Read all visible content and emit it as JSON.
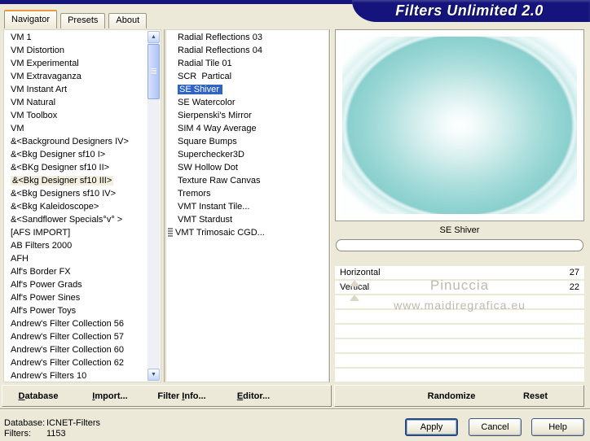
{
  "window": {
    "title": "Filters Unlimited 2.0"
  },
  "tabs": [
    {
      "label": "Navigator",
      "active": true
    },
    {
      "label": "Presets",
      "active": false
    },
    {
      "label": "About",
      "active": false
    }
  ],
  "icons": {
    "scroll_up": "▲",
    "scroll_down": "▼",
    "list_lines": "stack-lines"
  },
  "category_list": {
    "selected_index": 11,
    "items": [
      "VM 1",
      "VM Distortion",
      "VM Experimental",
      "VM Extravaganza",
      "VM Instant Art",
      "VM Natural",
      "VM Toolbox",
      "VM",
      "&<Background Designers IV>",
      "&<Bkg Designer sf10 I>",
      "&<BKg Designer sf10 II>",
      "&<Bkg Designer sf10 III>",
      "&<Bkg Designers sf10 IV>",
      "&<Bkg Kaleidoscope>",
      "&<Sandflower Specials°v° >",
      "[AFS IMPORT]",
      "AB Filters 2000",
      "AFH",
      "Alf's Border FX",
      "Alf's Power Grads",
      "Alf's Power Sines",
      "Alf's Power Toys",
      "Andrew's Filter Collection 56",
      "Andrew's Filter Collection 57",
      "Andrew's Filter Collection 60",
      "Andrew's Filter Collection 62",
      "Andrew's Filters 10"
    ]
  },
  "filter_list": {
    "selected_index": 4,
    "icon_item_index": 15,
    "items": [
      "Radial Reflections 03",
      "Radial Reflections 04",
      "Radial Tile 01",
      "SCR  Partical",
      "SE Shiver",
      "SE Watercolor",
      "Sierpenski's Mirror",
      "SIM 4 Way Average",
      "Square Bumps",
      "Superchecker3D",
      "SW Hollow Dot",
      "Texture Raw Canvas",
      "Tremors",
      "VMT Instant Tile...",
      "VMT Stardust",
      "VMT Trimosaic CGD..."
    ]
  },
  "preview": {
    "filter_name": "SE Shiver"
  },
  "sliders": {
    "rows": [
      {
        "label": "Horizontal",
        "value": "27",
        "thumb_percent": 6
      },
      {
        "label": "Vertical",
        "value": "22",
        "thumb_percent": 6
      }
    ],
    "empty_row_count": 6
  },
  "watermark": {
    "line1": "Pinuccia",
    "line2": "www.maidiregrafica.eu"
  },
  "toolbar": {
    "left_buttons": [
      {
        "label": "Database",
        "mnemonic_index": 0
      },
      {
        "label": "Import...",
        "mnemonic_index": 0
      },
      {
        "label": "Filter Info...",
        "mnemonic_index": 7
      },
      {
        "label": "Editor...",
        "mnemonic_index": 0
      }
    ],
    "right_buttons": [
      {
        "label": "Randomize",
        "mnemonic_index": -1
      },
      {
        "label": "Reset",
        "mnemonic_index": -1
      }
    ]
  },
  "status": {
    "database_label": "Database:",
    "database_value": "ICNET-Filters",
    "filters_label": "Filters:",
    "filters_value": "1153"
  },
  "action_buttons": {
    "apply": "Apply",
    "cancel": "Cancel",
    "help": "Help"
  },
  "colors": {
    "background": "#ece9d8",
    "banner": "#14147c",
    "tab_accent": "#e89a3c",
    "selection": "#2f63c5",
    "category_highlight": "#f2efdf",
    "preview_teal": "#8ad0ce"
  }
}
